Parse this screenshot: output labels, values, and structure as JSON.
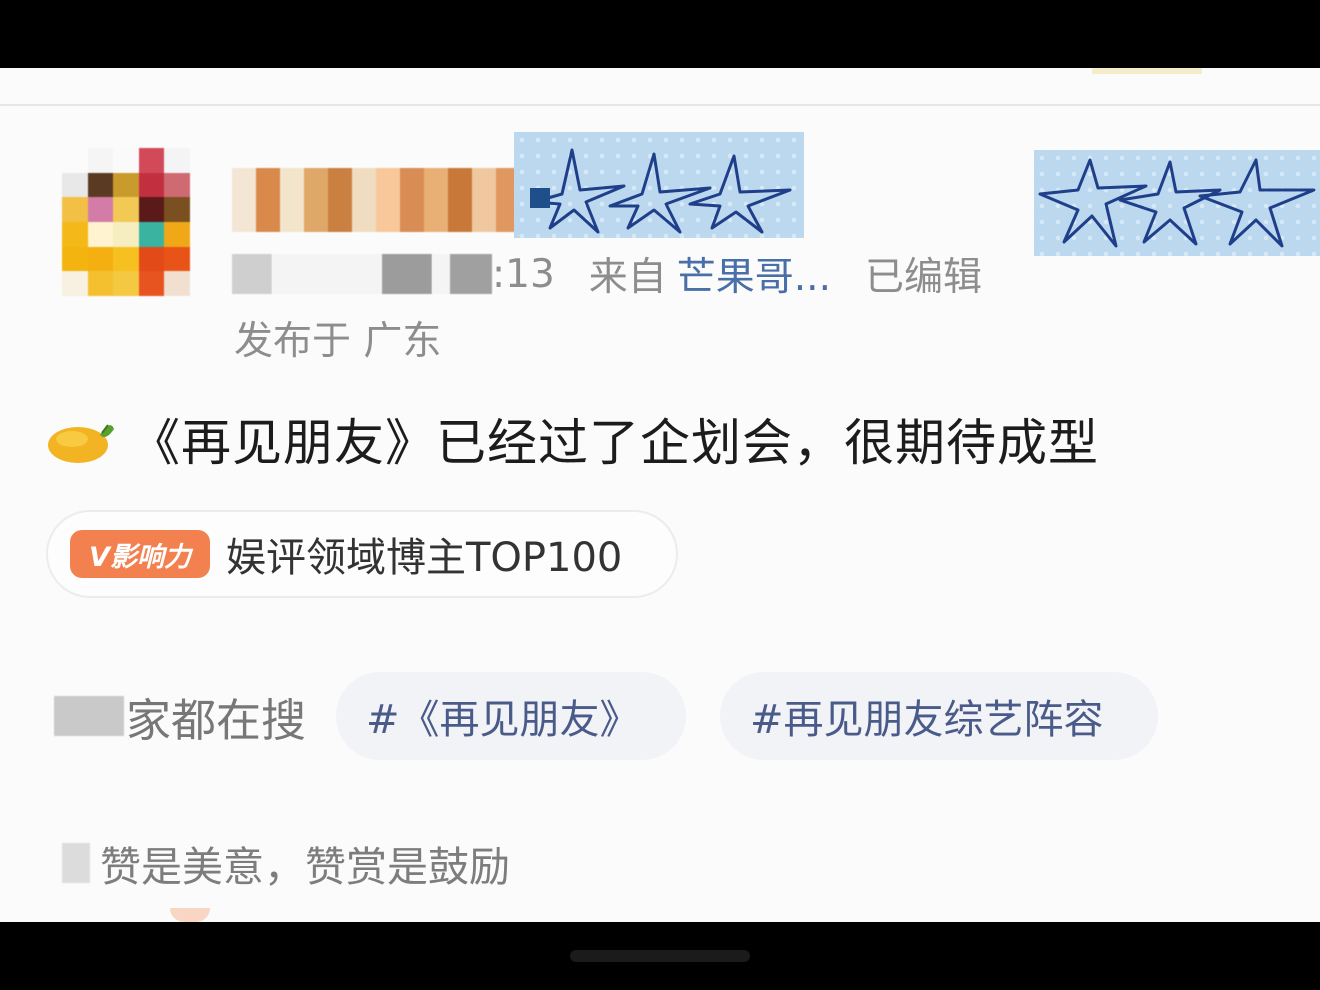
{
  "post": {
    "meta": {
      "time_suffix": ":13",
      "from_prefix": "来自",
      "source_name": "芒果哥...",
      "edited_label": "已编辑"
    },
    "location": "发布于 广东",
    "text": "《再见朋友》已经过了企划会，很期待成型"
  },
  "influence": {
    "badge_label": "V影响力",
    "text": "娱评领域博主TOP100"
  },
  "search": {
    "label_visible": "家都在搜",
    "hashtags": [
      "#《再见朋友》",
      "#再见朋友综艺阵容"
    ]
  },
  "reward": {
    "text": "赞是美意，赞赏是鼓励"
  },
  "icons": {
    "mango": "mango-emoji-icon",
    "star_sticker": "star-sticker-icon"
  },
  "colors": {
    "link_blue": "#4a6fa8",
    "meta_gray": "#8d8d8d",
    "badge_orange": "#f2814f",
    "hashtag_text": "#4a5b8a",
    "hashtag_bg": "#f1f3f7",
    "sticker_blue": "#bcd8ee"
  }
}
